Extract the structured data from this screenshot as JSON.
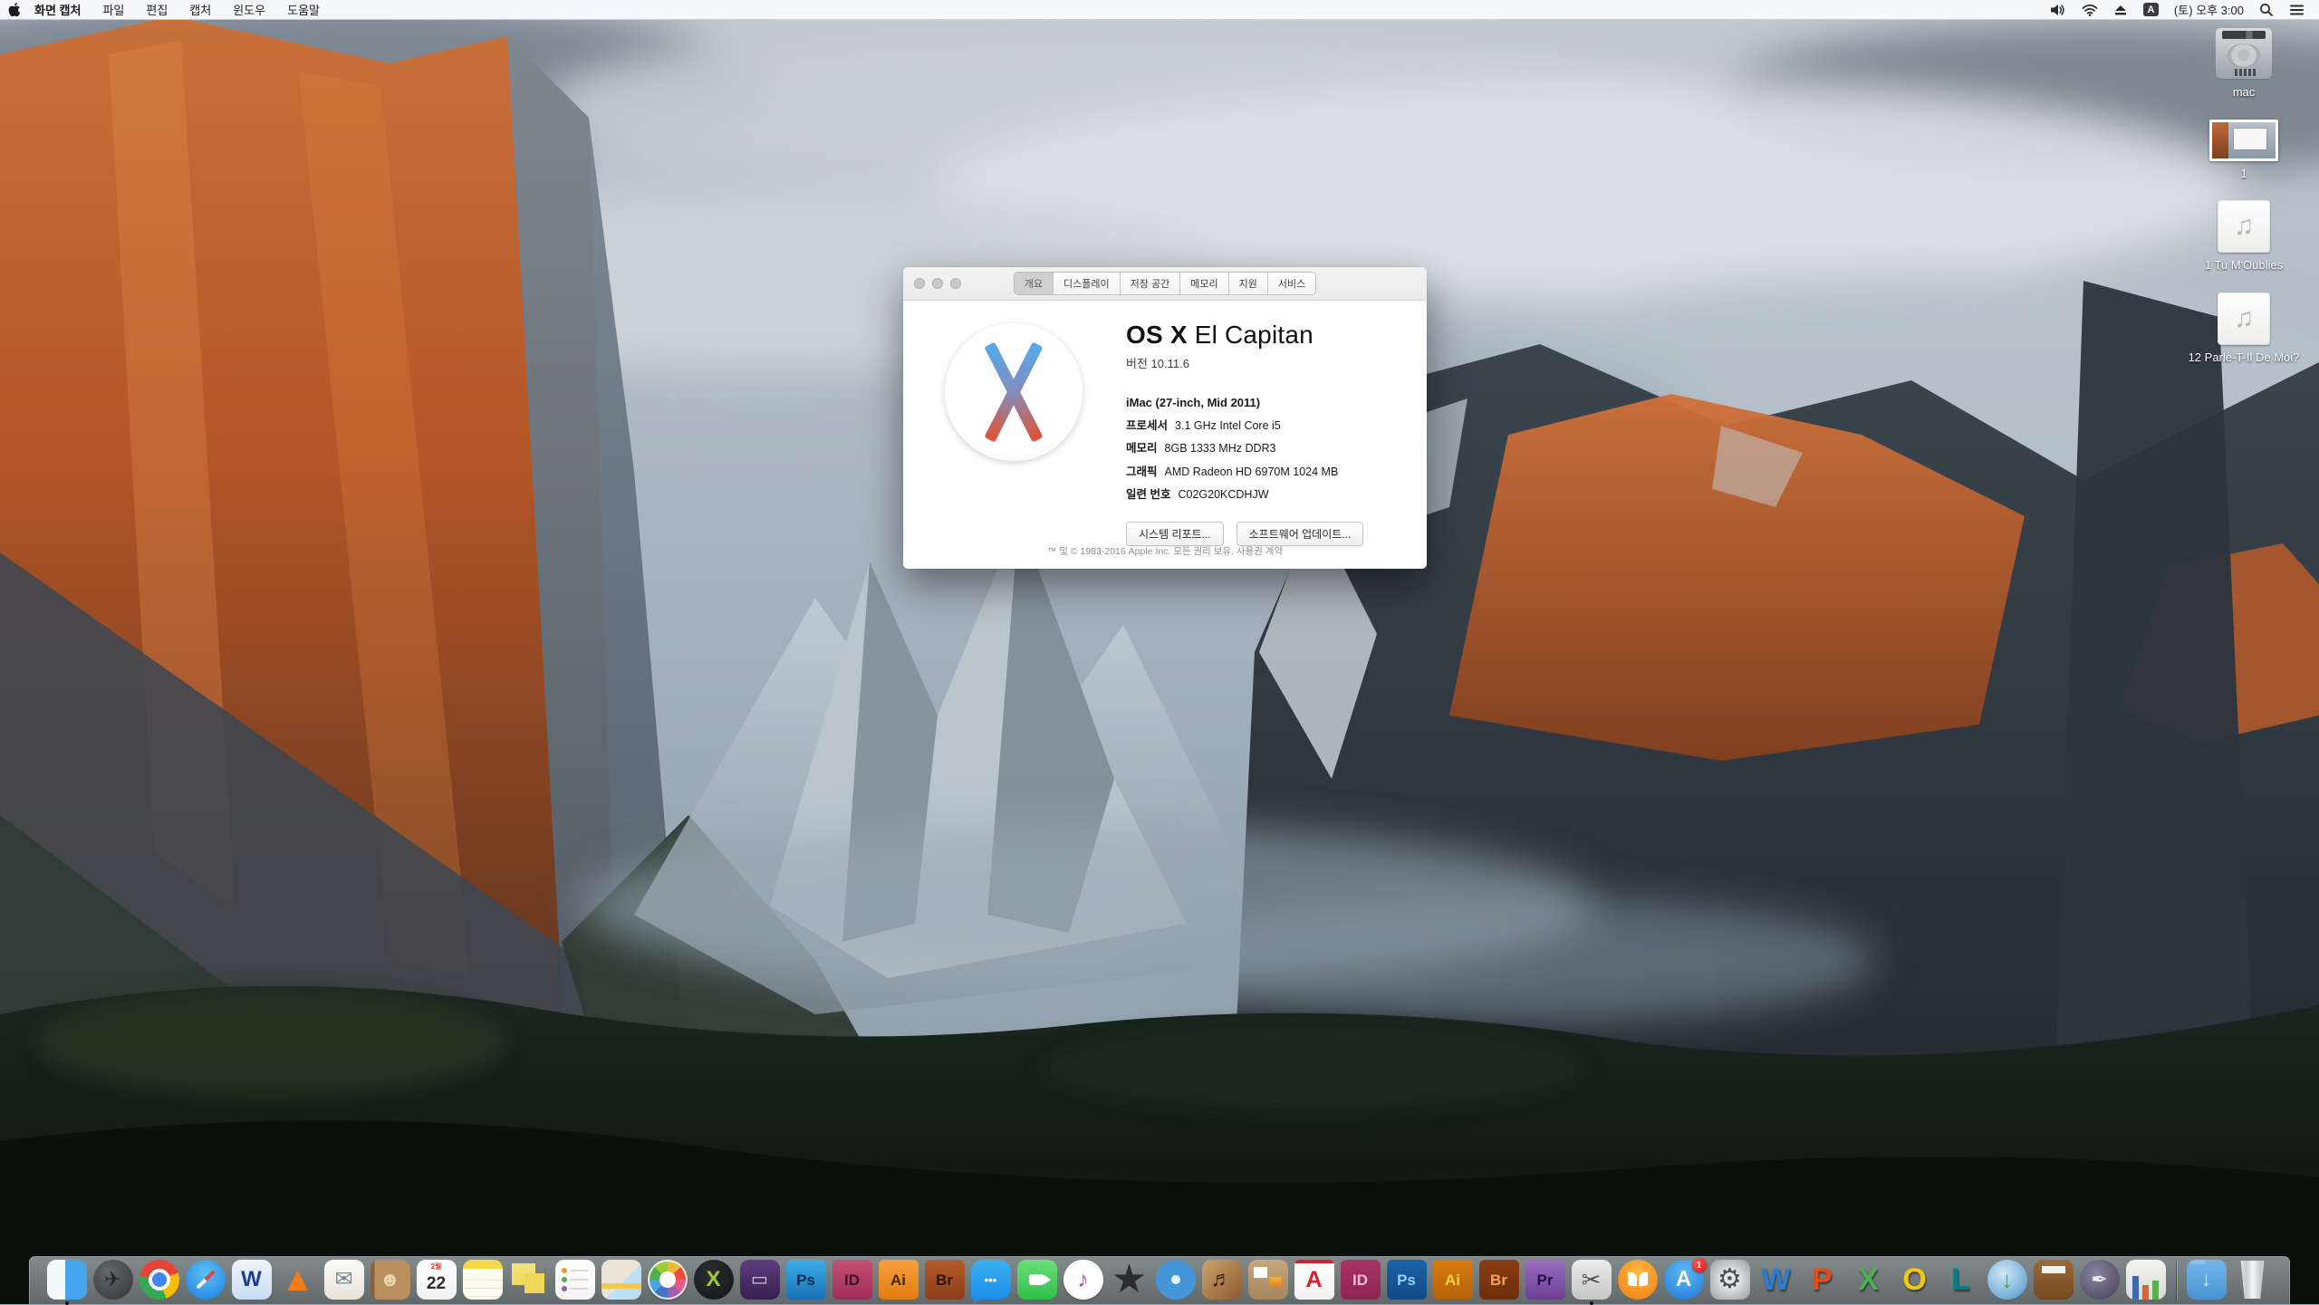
{
  "menu_bar": {
    "items": [
      {
        "id": "app",
        "label": "화면 캡처",
        "bold": true
      },
      {
        "id": "file",
        "label": "파일",
        "bold": false
      },
      {
        "id": "edit",
        "label": "편집",
        "bold": false
      },
      {
        "id": "capture",
        "label": "캡처",
        "bold": false
      },
      {
        "id": "window",
        "label": "윈도우",
        "bold": false
      },
      {
        "id": "help",
        "label": "도움말",
        "bold": false
      }
    ],
    "status": {
      "input_badge": "A",
      "clock": "(토) 오후 3:00"
    }
  },
  "about_window": {
    "tabs": [
      {
        "id": "overview",
        "label": "개요",
        "active": true
      },
      {
        "id": "displays",
        "label": "디스플레이",
        "active": false
      },
      {
        "id": "storage",
        "label": "저장 공간",
        "active": false
      },
      {
        "id": "memory",
        "label": "메모리",
        "active": false
      },
      {
        "id": "support",
        "label": "지원",
        "active": false
      },
      {
        "id": "service",
        "label": "서비스",
        "active": false
      }
    ],
    "title_strong": "OS X",
    "title_light": " El Capitan",
    "version": "버전 10.11.6",
    "model": "iMac (27-inch, Mid 2011)",
    "specs": [
      {
        "label": "프로세서",
        "value": "3.1 GHz Intel Core i5"
      },
      {
        "label": "메모리",
        "value": "8GB 1333 MHz DDR3"
      },
      {
        "label": "그래픽",
        "value": "AMD Radeon HD 6970M 1024 MB"
      },
      {
        "label": "일련 번호",
        "value": "C02G20KCDHJW"
      }
    ],
    "buttons": [
      "시스템 리포트...",
      "소프트웨어 업데이트..."
    ],
    "footer": "™ 및 © 1983-2016 Apple Inc. 모든 권리 보유. 사용권 계약"
  },
  "desktop": {
    "items": [
      {
        "name": "mac-drive",
        "type": "drive",
        "label": "mac"
      },
      {
        "name": "screenshot-file",
        "type": "image",
        "label": "1"
      },
      {
        "name": "audio-file-1",
        "type": "audio",
        "glyph": "♫",
        "label": "1 Tu M'Oublies"
      },
      {
        "name": "audio-file-2",
        "type": "audio",
        "glyph": "♫",
        "label": "12 Parle-T-Il De Moi?"
      }
    ]
  },
  "dock": {
    "items": [
      {
        "name": "finder",
        "shape": "squircle",
        "bg": "linear-gradient(90deg,#f4f8fb 0 46%,#45a6ee 46% 100%)",
        "glyph": "",
        "running": true
      },
      {
        "name": "launchpad",
        "shape": "circle",
        "bg": "radial-gradient(circle at 38% 30%,#63676a,#333638)",
        "glyph": "✈",
        "fg": "#25282a",
        "size": 22
      },
      {
        "name": "chrome",
        "shape": "circle",
        "bg": "radial-gradient(circle at 50% 50%, #4285f4 0 8px, #ffffff 8px 12px, rgba(0,0,0,0) 12px), conic-gradient(from -50deg, #ea4335 0 120deg, #fbbc05 120deg 210deg, #34a853 210deg 330deg, #ea4335 330deg)",
        "glyph": ""
      },
      {
        "name": "safari",
        "shape": "circle",
        "bg": "radial-gradient(circle at 50% 35%,#5ec1f2,#1b7de0)",
        "glyph": "",
        "deco": "compass"
      },
      {
        "name": "w-browser",
        "shape": "squircle",
        "bg": "linear-gradient(180deg,#eef4fb,#c9ddf2)",
        "glyph": "W",
        "fg": "#1e3f90",
        "size": 24,
        "weight": "bold"
      },
      {
        "name": "vlc",
        "shape": "none",
        "bg": "",
        "glyph": "▲",
        "fg": "#f57c14",
        "size": 38
      },
      {
        "name": "mail",
        "shape": "squircle",
        "bg": "linear-gradient(180deg,#fcfcfa,#e7e3d8)",
        "glyph": "✉",
        "fg": "#74869a",
        "size": 24
      },
      {
        "name": "contacts",
        "shape": "squircle",
        "bg": "linear-gradient(90deg,#8a6138 0 10%, #b98f5d 10%)",
        "glyph": "☻",
        "fg": "#e9d5ac",
        "size": 22
      },
      {
        "name": "calendar",
        "shape": "squircle",
        "bg": "linear-gradient(180deg,#ffffff,#f1f1f1)",
        "glyph": "22",
        "fg": "#2b2b2b",
        "size": 19,
        "weight": "bold",
        "top": "2월"
      },
      {
        "name": "notes",
        "shape": "squircle",
        "bg": "repeating-linear-gradient(180deg, rgba(0,0,0,0) 0 8px, #e8e4d6 8px 9px) 0 14px/100% 100% no-repeat, linear-gradient(180deg,#f6d847 0 10px,#fffdf2 10px)",
        "glyph": ""
      },
      {
        "name": "stickies",
        "shape": "none",
        "bg": "linear-gradient(#efd75a,#efd75a) 17px 15px/22px 22px no-repeat, linear-gradient(#f5e47c,#ecd95e) 3px 4px/26px 24px no-repeat",
        "glyph": ""
      },
      {
        "name": "reminders",
        "shape": "squircle",
        "bg": "radial-gradient(circle 3px at 10px 12px, #f59b2d 98%, rgba(0,0,0,0)), radial-gradient(circle 3px at 10px 22px, #53b153 98%, rgba(0,0,0,0)), radial-gradient(circle 3px at 10px 32px, #9b59b6 98%, rgba(0,0,0,0)), linear-gradient(#d9d9d9,#d9d9d9) 17px 11px/19px 2px no-repeat, linear-gradient(#d9d9d9,#d9d9d9) 17px 21px/19px 2px no-repeat, linear-gradient(#d9d9d9,#d9d9d9) 17px 31px/19px 2px no-repeat, linear-gradient(180deg,#ffffff,#f3f3f3)",
        "glyph": ""
      },
      {
        "name": "maps",
        "shape": "squircle",
        "bg": "linear-gradient(#f2c94c,#f2c94c) 0 26px/100% 6px no-repeat, linear-gradient(135deg,#e9e4d6 0 55%, #bfe0f2 55% 100%)",
        "glyph": ""
      },
      {
        "name": "photos",
        "shape": "circle",
        "bg": "radial-gradient(circle at 50% 50%, #ffffff 0 9px, rgba(0,0,0,0) 9px), conic-gradient(#f2b53a 0 45deg, #ea4d3c 45deg 90deg, #e85a8a 90deg 135deg, #a05bb5 135deg 180deg, #4472c4 180deg 225deg, #45a6e0 225deg 270deg, #4caf50 270deg 315deg, #9ccb3b 315deg 360deg)",
        "glyph": "",
        "ring": true
      },
      {
        "name": "quarkxpress",
        "shape": "circle",
        "bg": "radial-gradient(circle at 40% 35%,#2c2f31,#121415)",
        "glyph": "X",
        "fg": "#9ccb3b",
        "size": 24,
        "weight": "bold"
      },
      {
        "name": "toast",
        "shape": "squircle",
        "bg": "linear-gradient(180deg,#5f3d7e,#362050)",
        "glyph": "▭",
        "fg": "#d8cde8",
        "size": 20
      },
      {
        "name": "photoshop-cs",
        "shape": "square",
        "bg": "linear-gradient(180deg,#3caee8,#1b6fb5)",
        "glyph": "Ps",
        "fg": "#082f4e",
        "size": 17,
        "weight": "bold"
      },
      {
        "name": "indesign-cs",
        "shape": "square",
        "bg": "linear-gradient(180deg,#c74f74,#9c2d56)",
        "glyph": "ID",
        "fg": "#3d0f24",
        "size": 17,
        "weight": "bold"
      },
      {
        "name": "illustrator-cs",
        "shape": "square",
        "bg": "linear-gradient(180deg,#f6a13b,#e07c12)",
        "glyph": "Ai",
        "fg": "#46260a",
        "size": 17,
        "weight": "bold"
      },
      {
        "name": "bridge-cs",
        "shape": "square",
        "bg": "linear-gradient(180deg,#b65a2a,#8a3f1a)",
        "glyph": "Br",
        "fg": "#2f1507",
        "size": 17,
        "weight": "bold"
      },
      {
        "name": "messages",
        "shape": "squircle",
        "bg": "linear-gradient(180deg,#3bb2f2,#1d8ce8)",
        "glyph": "•••",
        "fg": "#ffffff",
        "size": 13,
        "weight": "bold",
        "tileClass": "bubble"
      },
      {
        "name": "facetime",
        "shape": "squircle",
        "bg": "linear-gradient(180deg,#6de07a,#2fbf4a)",
        "glyph": "",
        "deco": "camera"
      },
      {
        "name": "itunes",
        "shape": "circle",
        "bg": "radial-gradient(circle at 50% 42%, #ffffff 0 60%, #f0eff4 100%)",
        "glyph": "♪",
        "fg": "#d84a9e",
        "size": 25,
        "ring": true
      },
      {
        "name": "imovie",
        "shape": "none",
        "bg": "",
        "glyph": "★",
        "fg": "#2a2c2e",
        "size": 44
      },
      {
        "name": "idvd",
        "shape": "circle",
        "bg": "radial-gradient(circle at 50% 50%, #dff1fb 0 5px, #4596d8 5px 70%, #2a6cb0 100%)",
        "glyph": ""
      },
      {
        "name": "garageband",
        "shape": "squircle",
        "bg": "linear-gradient(135deg,#cba46c,#8a5a30)",
        "glyph": "♬",
        "fg": "#3c2510",
        "size": 24
      },
      {
        "name": "iphoto-collage",
        "shape": "squircle",
        "bg": "linear-gradient(#ffffff,#ffffff) 6px 8px/15px 12px no-repeat, linear-gradient(#f2b53a,#e07c30) 23px 19px/14px 12px no-repeat, linear-gradient(180deg,#c8a87c,#a5855c)",
        "glyph": ""
      },
      {
        "name": "acrobat-reader",
        "shape": "square",
        "bg": "linear-gradient(#d2222a,#d2222a) 0 0/100% 4px no-repeat, linear-gradient(180deg,#ffffff,#f2f2f2)",
        "glyph": "A",
        "fg": "#d2222a",
        "size": 25,
        "weight": "bold"
      },
      {
        "name": "indesign-cc",
        "shape": "square",
        "bg": "linear-gradient(180deg,#a83462,#8c2450)",
        "glyph": "ID",
        "fg": "#f7b8d4",
        "size": 17,
        "weight": "bold"
      },
      {
        "name": "photoshop-cc",
        "shape": "square",
        "bg": "linear-gradient(180deg,#1c63a8,#104a84)",
        "glyph": "Ps",
        "fg": "#8fd0f7",
        "size": 17,
        "weight": "bold"
      },
      {
        "name": "illustrator-cc",
        "shape": "square",
        "bg": "linear-gradient(180deg,#d97c0e,#b3620a)",
        "glyph": "Ai",
        "fg": "#f7d047",
        "size": 17,
        "weight": "bold"
      },
      {
        "name": "bridge-cc",
        "shape": "square",
        "bg": "linear-gradient(180deg,#8a3c12,#6e2e0c)",
        "glyph": "Br",
        "fg": "#f0a35e",
        "size": 17,
        "weight": "bold"
      },
      {
        "name": "premiere",
        "shape": "square",
        "bg": "linear-gradient(180deg,#9a6fc0,#6a3f95)",
        "glyph": "Pr",
        "fg": "#2a0f45",
        "size": 17,
        "weight": "bold"
      },
      {
        "name": "grab",
        "shape": "squircle",
        "bg": "linear-gradient(180deg,#ececec,#c6c6c6)",
        "glyph": "✂",
        "fg": "#4f4f4f",
        "size": 26,
        "running": true
      },
      {
        "name": "ibooks",
        "shape": "circle",
        "bg": "radial-gradient(circle at 50% 30%,#ffb53e,#f07f17)",
        "glyph": "",
        "deco": "book"
      },
      {
        "name": "app-store",
        "shape": "circle",
        "bg": "radial-gradient(circle at 50% 30%,#5fb8f2,#1f7ad8)",
        "glyph": "A",
        "fg": "#ffffff",
        "size": 24,
        "weight": "bold",
        "badge": "1"
      },
      {
        "name": "system-preferences",
        "shape": "squircle",
        "bg": "radial-gradient(circle at 50% 50%,#e3e5e7 0 30%,#969ca0 100%)",
        "glyph": "⚙",
        "fg": "#4a4e52",
        "size": 30
      },
      {
        "name": "word",
        "shape": "none",
        "bg": "",
        "glyph": "W",
        "fg": "#2b7cd3",
        "size": 34,
        "weight": "bold",
        "shadow": true
      },
      {
        "name": "powerpoint",
        "shape": "none",
        "bg": "",
        "glyph": "P",
        "fg": "#e64a19",
        "size": 34,
        "weight": "bold",
        "shadow": true
      },
      {
        "name": "excel",
        "shape": "none",
        "bg": "",
        "glyph": "X",
        "fg": "#4caf50",
        "size": 34,
        "weight": "bold",
        "shadow": true
      },
      {
        "name": "outlook",
        "shape": "none",
        "bg": "",
        "glyph": "O",
        "fg": "#f2c811",
        "size": 34,
        "weight": "bold",
        "shadow": true
      },
      {
        "name": "lync",
        "shape": "none",
        "bg": "",
        "glyph": "L",
        "fg": "#00808c",
        "size": 34,
        "weight": "bold",
        "shadow": true
      },
      {
        "name": "internet-downloader",
        "shape": "circle",
        "bg": "radial-gradient(circle at 40% 35%,#cfe9f7,#4f93c9)",
        "glyph": "↓",
        "fg": "#3fae49",
        "size": 26,
        "weight": "bold"
      },
      {
        "name": "keynote",
        "shape": "squircle",
        "bg": "linear-gradient(#f2f0ec,#f2f0ec) 50% 7px/26px 8px no-repeat, linear-gradient(180deg,#9a6a38,#744a22)",
        "glyph": ""
      },
      {
        "name": "pages",
        "shape": "circle",
        "bg": "radial-gradient(circle at 40% 35%, #8a84a0, #443e54)",
        "glyph": "✒",
        "fg": "#eceaf2",
        "size": 22
      },
      {
        "name": "numbers",
        "shape": "squircle",
        "bg": "linear-gradient(#3f68b3,#3f68b3) 7px 100%/7px 26px no-repeat, linear-gradient(#e0622f,#e0622f) 18px 100%/7px 16px no-repeat, linear-gradient(#58b14c,#58b14c) 29px 100%/7px 21px no-repeat, linear-gradient(180deg,#f4f4f2,#d9d9d5)",
        "glyph": ""
      },
      {
        "name": "separator",
        "type": "separator"
      },
      {
        "name": "downloads-folder",
        "shape": "squircle",
        "bg": "linear-gradient(#86c4f0,#86c4f0) 4px 0/16px 5px no-repeat, linear-gradient(180deg,#74b8ea,#4792d2)",
        "glyph": "↓",
        "fg": "#dceffb",
        "size": 22,
        "weight": "bold"
      },
      {
        "name": "trash",
        "shape": "none",
        "bg": "",
        "glyph": "",
        "tileClass": "trash-shape"
      }
    ]
  },
  "colors": {
    "menu_bar_bg": "#f9fafb",
    "dock_bg": "#7b8385",
    "badge_red": "#dd1111",
    "tab_selected": "#cfcfcf",
    "logo_blue": "#56a9e8",
    "logo_red": "#e2512f"
  }
}
